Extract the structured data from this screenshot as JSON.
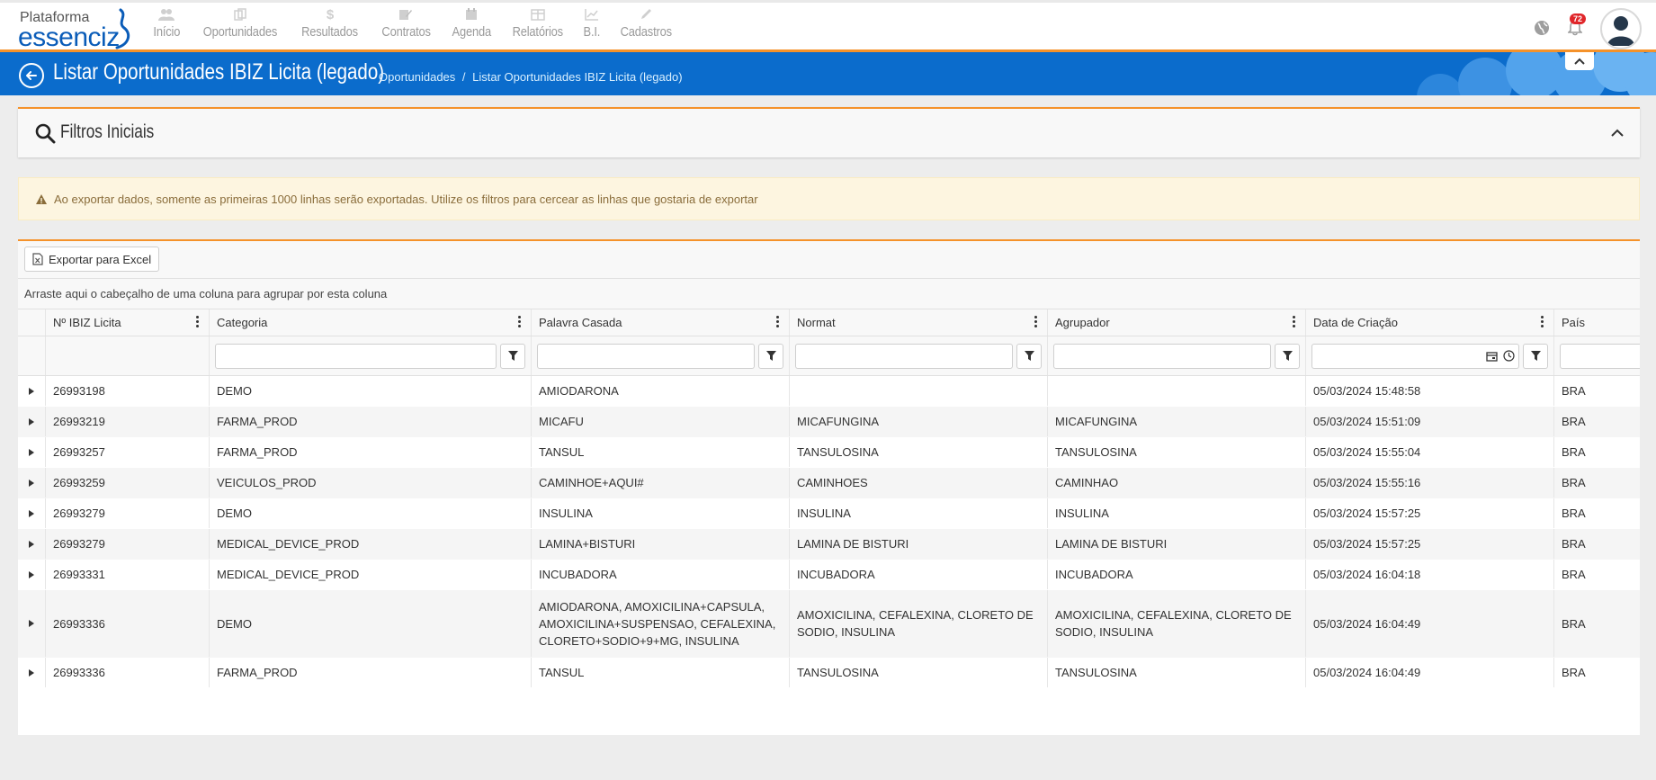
{
  "nav": {
    "logo_top": "Plataforma",
    "logo_bottom": "essenciz",
    "items": [
      {
        "label": "Início",
        "icon": "users-icon"
      },
      {
        "label": "Oportunidades",
        "icon": "copy-icon"
      },
      {
        "label": "Resultados",
        "icon": "dollar-icon"
      },
      {
        "label": "Contratos",
        "icon": "edit-icon"
      },
      {
        "label": "Agenda",
        "icon": "calendar-icon"
      },
      {
        "label": "Relatórios",
        "icon": "table-icon"
      },
      {
        "label": "B.I.",
        "icon": "chart-line-icon"
      },
      {
        "label": "Cadastros",
        "icon": "pencil-icon"
      }
    ],
    "notification_count": "72"
  },
  "header": {
    "title": "Listar Oportunidades IBIZ Licita (legado)",
    "breadcrumb_parent": "Oportunidades",
    "breadcrumb_sep": "/",
    "breadcrumb_current": "Listar Oportunidades IBIZ Licita (legado)"
  },
  "filters": {
    "title": "Filtros Iniciais"
  },
  "warning": {
    "text": "Ao exportar dados, somente as primeiras 1000 linhas serão exportadas. Utilize os filtros para cercear as linhas que gostaria de exportar"
  },
  "grid": {
    "export_label": "Exportar para Excel",
    "group_hint": "Arraste aqui o cabeçalho de uma coluna para agrupar por esta coluna",
    "columns": [
      "Nº IBIZ Licita",
      "Categoria",
      "Palavra Casada",
      "Normat",
      "Agrupador",
      "Data de Criação",
      "País"
    ],
    "rows": [
      {
        "id": "26993198",
        "categoria": "DEMO",
        "palavra": "AMIODARONA",
        "normat": "",
        "agrupador": "",
        "data": "05/03/2024 15:48:58",
        "pais": "BRA"
      },
      {
        "id": "26993219",
        "categoria": "FARMA_PROD",
        "palavra": "MICAFU",
        "normat": "MICAFUNGINA",
        "agrupador": "MICAFUNGINA",
        "data": "05/03/2024 15:51:09",
        "pais": "BRA"
      },
      {
        "id": "26993257",
        "categoria": "FARMA_PROD",
        "palavra": "TANSUL",
        "normat": "TANSULOSINA",
        "agrupador": "TANSULOSINA",
        "data": "05/03/2024 15:55:04",
        "pais": "BRA"
      },
      {
        "id": "26993259",
        "categoria": "VEICULOS_PROD",
        "palavra": "CAMINHOE+AQUI#",
        "normat": "CAMINHOES",
        "agrupador": "CAMINHAO",
        "data": "05/03/2024 15:55:16",
        "pais": "BRA"
      },
      {
        "id": "26993279",
        "categoria": "DEMO",
        "palavra": "INSULINA",
        "normat": "INSULINA",
        "agrupador": "INSULINA",
        "data": "05/03/2024 15:57:25",
        "pais": "BRA"
      },
      {
        "id": "26993279",
        "categoria": "MEDICAL_DEVICE_PROD",
        "palavra": "LAMINA+BISTURI",
        "normat": "LAMINA DE BISTURI",
        "agrupador": "LAMINA DE BISTURI",
        "data": "05/03/2024 15:57:25",
        "pais": "BRA"
      },
      {
        "id": "26993331",
        "categoria": "MEDICAL_DEVICE_PROD",
        "palavra": "INCUBADORA",
        "normat": "INCUBADORA",
        "agrupador": "INCUBADORA",
        "data": "05/03/2024 16:04:18",
        "pais": "BRA"
      },
      {
        "id": "26993336",
        "categoria": "DEMO",
        "palavra": "AMIODARONA, AMOXICILINA+CAPSULA, AMOXICILINA+SUSPENSAO, CEFALEXINA, CLORETO+SODIO+9+MG, INSULINA",
        "normat": "AMOXICILINA, CEFALEXINA, CLORETO DE SODIO, INSULINA",
        "agrupador": "AMOXICILINA, CEFALEXINA, CLORETO DE SODIO, INSULINA",
        "data": "05/03/2024 16:04:49",
        "pais": "BRA"
      },
      {
        "id": "26993336",
        "categoria": "FARMA_PROD",
        "palavra": "TANSUL",
        "normat": "TANSULOSINA",
        "agrupador": "TANSULOSINA",
        "data": "05/03/2024 16:04:49",
        "pais": "BRA"
      }
    ]
  },
  "colors": {
    "brand_blue": "#0b6ccc",
    "accent_orange": "#f5922a",
    "badge_red": "#e0262a",
    "warning_bg": "#fdf5e0"
  }
}
